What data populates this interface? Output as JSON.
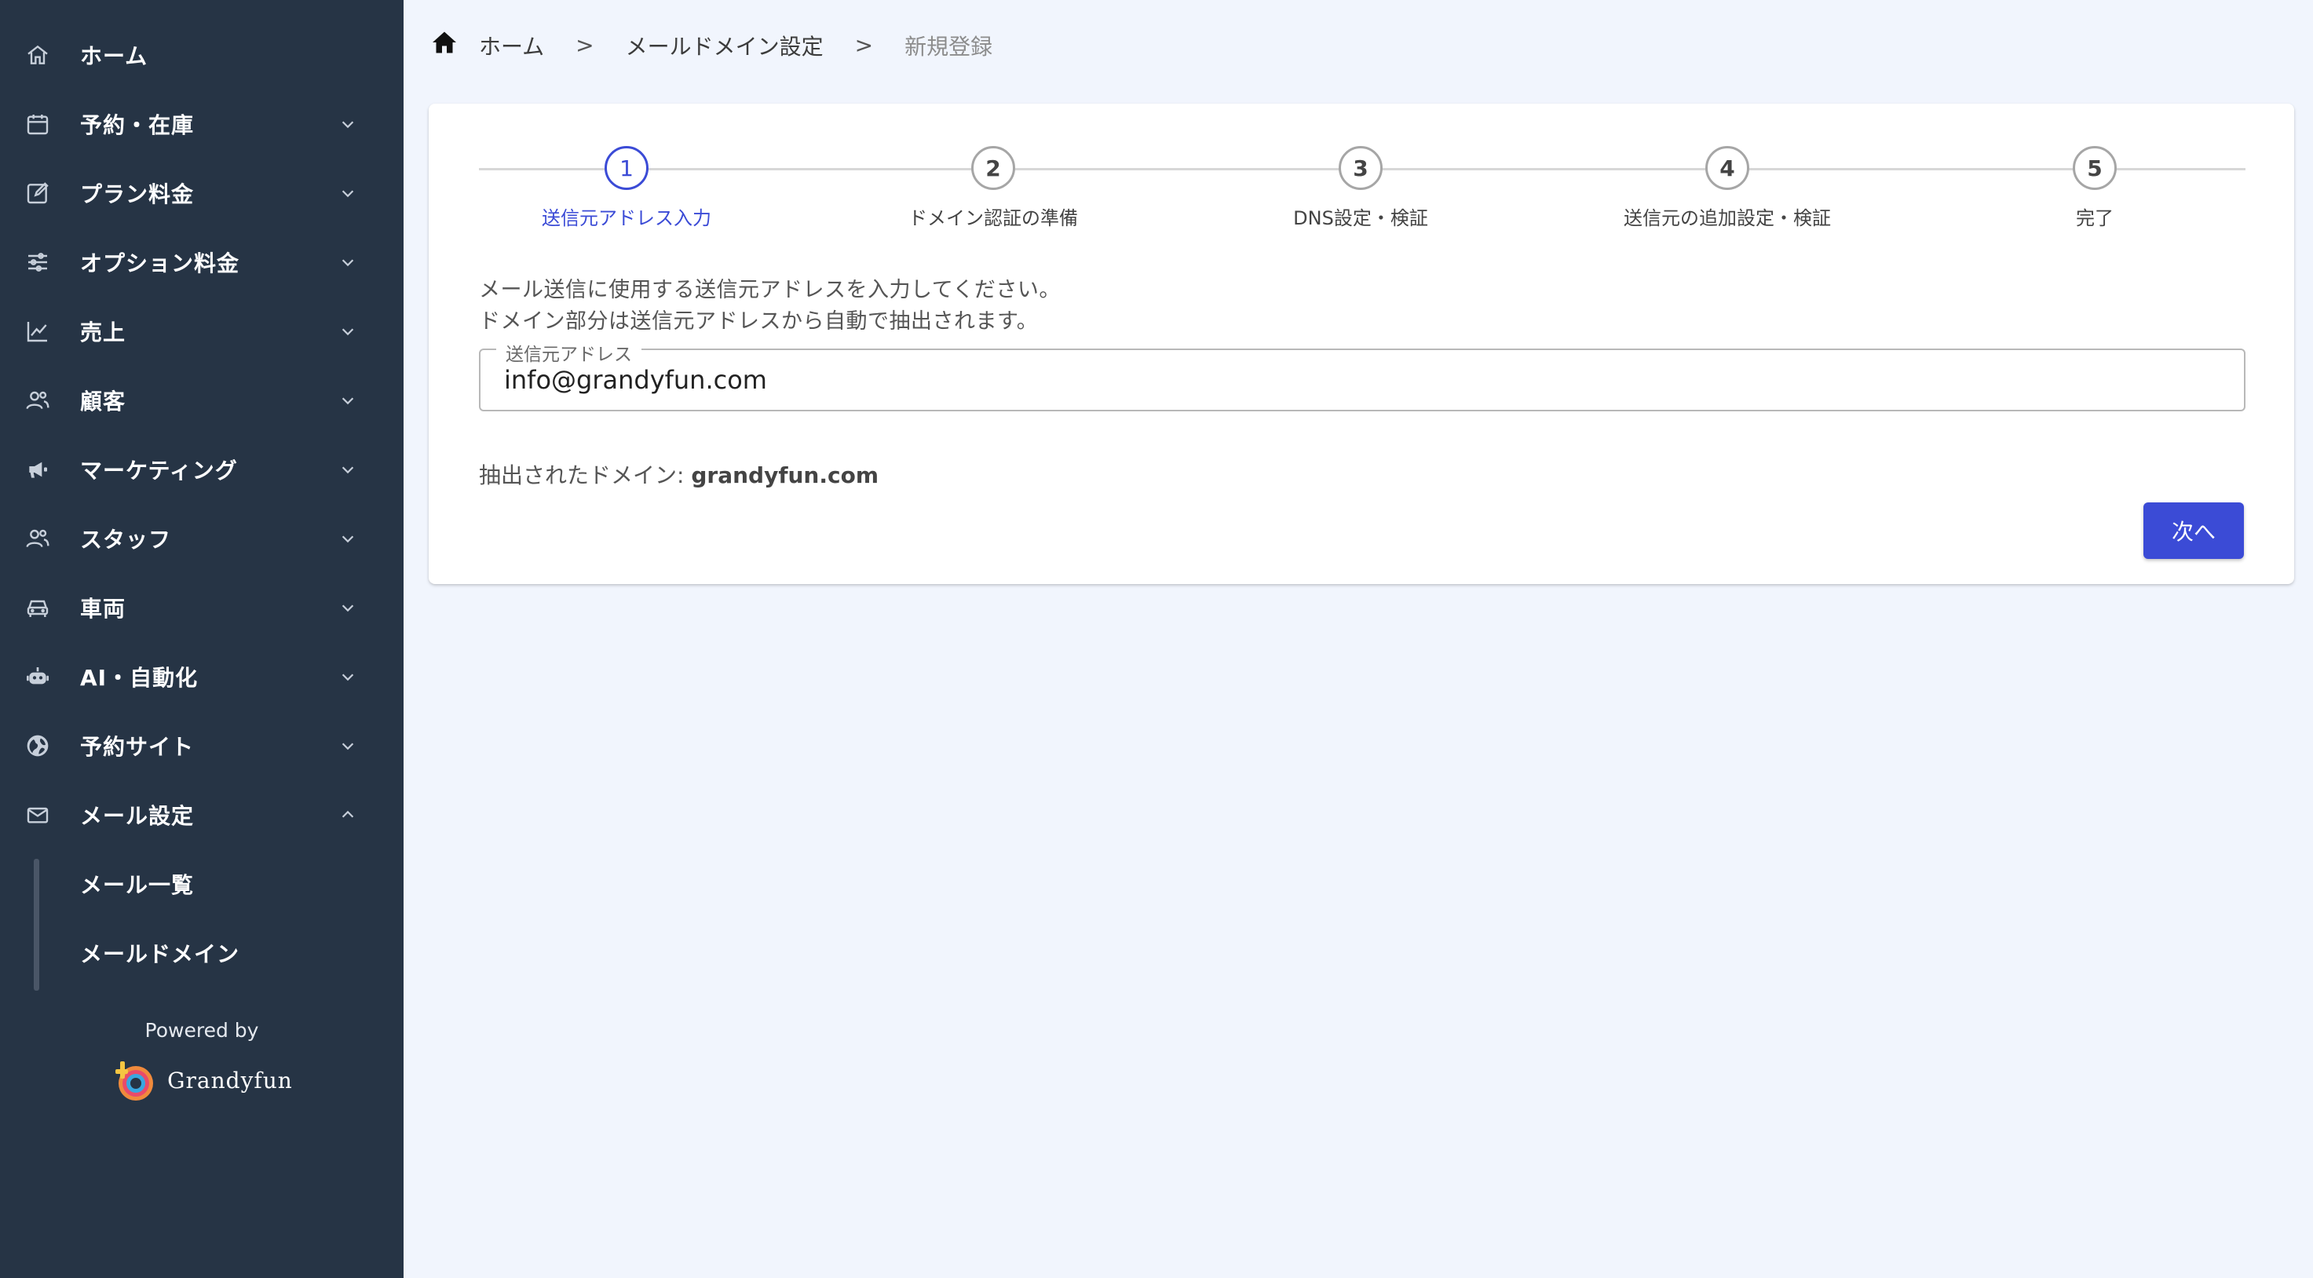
{
  "sidebar": {
    "items": [
      {
        "label": "ホーム",
        "icon": "home-icon"
      },
      {
        "label": "予約・在庫",
        "icon": "calendar-icon"
      },
      {
        "label": "プラン料金",
        "icon": "edit-icon"
      },
      {
        "label": "オプション料金",
        "icon": "sliders-icon"
      },
      {
        "label": "売上",
        "icon": "chart-line-icon"
      },
      {
        "label": "顧客",
        "icon": "users-icon"
      },
      {
        "label": "マーケティング",
        "icon": "megaphone-icon"
      },
      {
        "label": "スタッフ",
        "icon": "staff-icon"
      },
      {
        "label": "車両",
        "icon": "car-icon"
      },
      {
        "label": "AI・自動化",
        "icon": "robot-icon"
      },
      {
        "label": "予約サイト",
        "icon": "globe-icon"
      },
      {
        "label": "メール設定",
        "icon": "mail-icon"
      }
    ],
    "subitems": [
      "メール一覧",
      "メールドメイン"
    ],
    "powered_by": "Powered by",
    "brand": "Grandyfun"
  },
  "breadcrumb": {
    "items": [
      "ホーム",
      "メールドメイン設定",
      "新規登録"
    ],
    "separator": ">"
  },
  "stepper": {
    "steps": [
      {
        "num": "1",
        "label": "送信元アドレス入力"
      },
      {
        "num": "2",
        "label": "ドメイン認証の準備"
      },
      {
        "num": "3",
        "label": "DNS設定・検証"
      },
      {
        "num": "4",
        "label": "送信元の追加設定・検証"
      },
      {
        "num": "5",
        "label": "完了"
      }
    ]
  },
  "form": {
    "instruction_line1": "メール送信に使用する送信元アドレスを入力してください。",
    "instruction_line2": "ドメイン部分は送信元アドレスから自動で抽出されます。",
    "field_label": "送信元アドレス",
    "field_value": "info@grandyfun.com",
    "extracted_label": "抽出されたドメイン:",
    "extracted_value": "grandyfun.com",
    "next_label": "次へ"
  },
  "colors": {
    "sidebar_bg": "#263445",
    "accent": "#3b4bd6",
    "page_bg": "#f1f5fd"
  }
}
